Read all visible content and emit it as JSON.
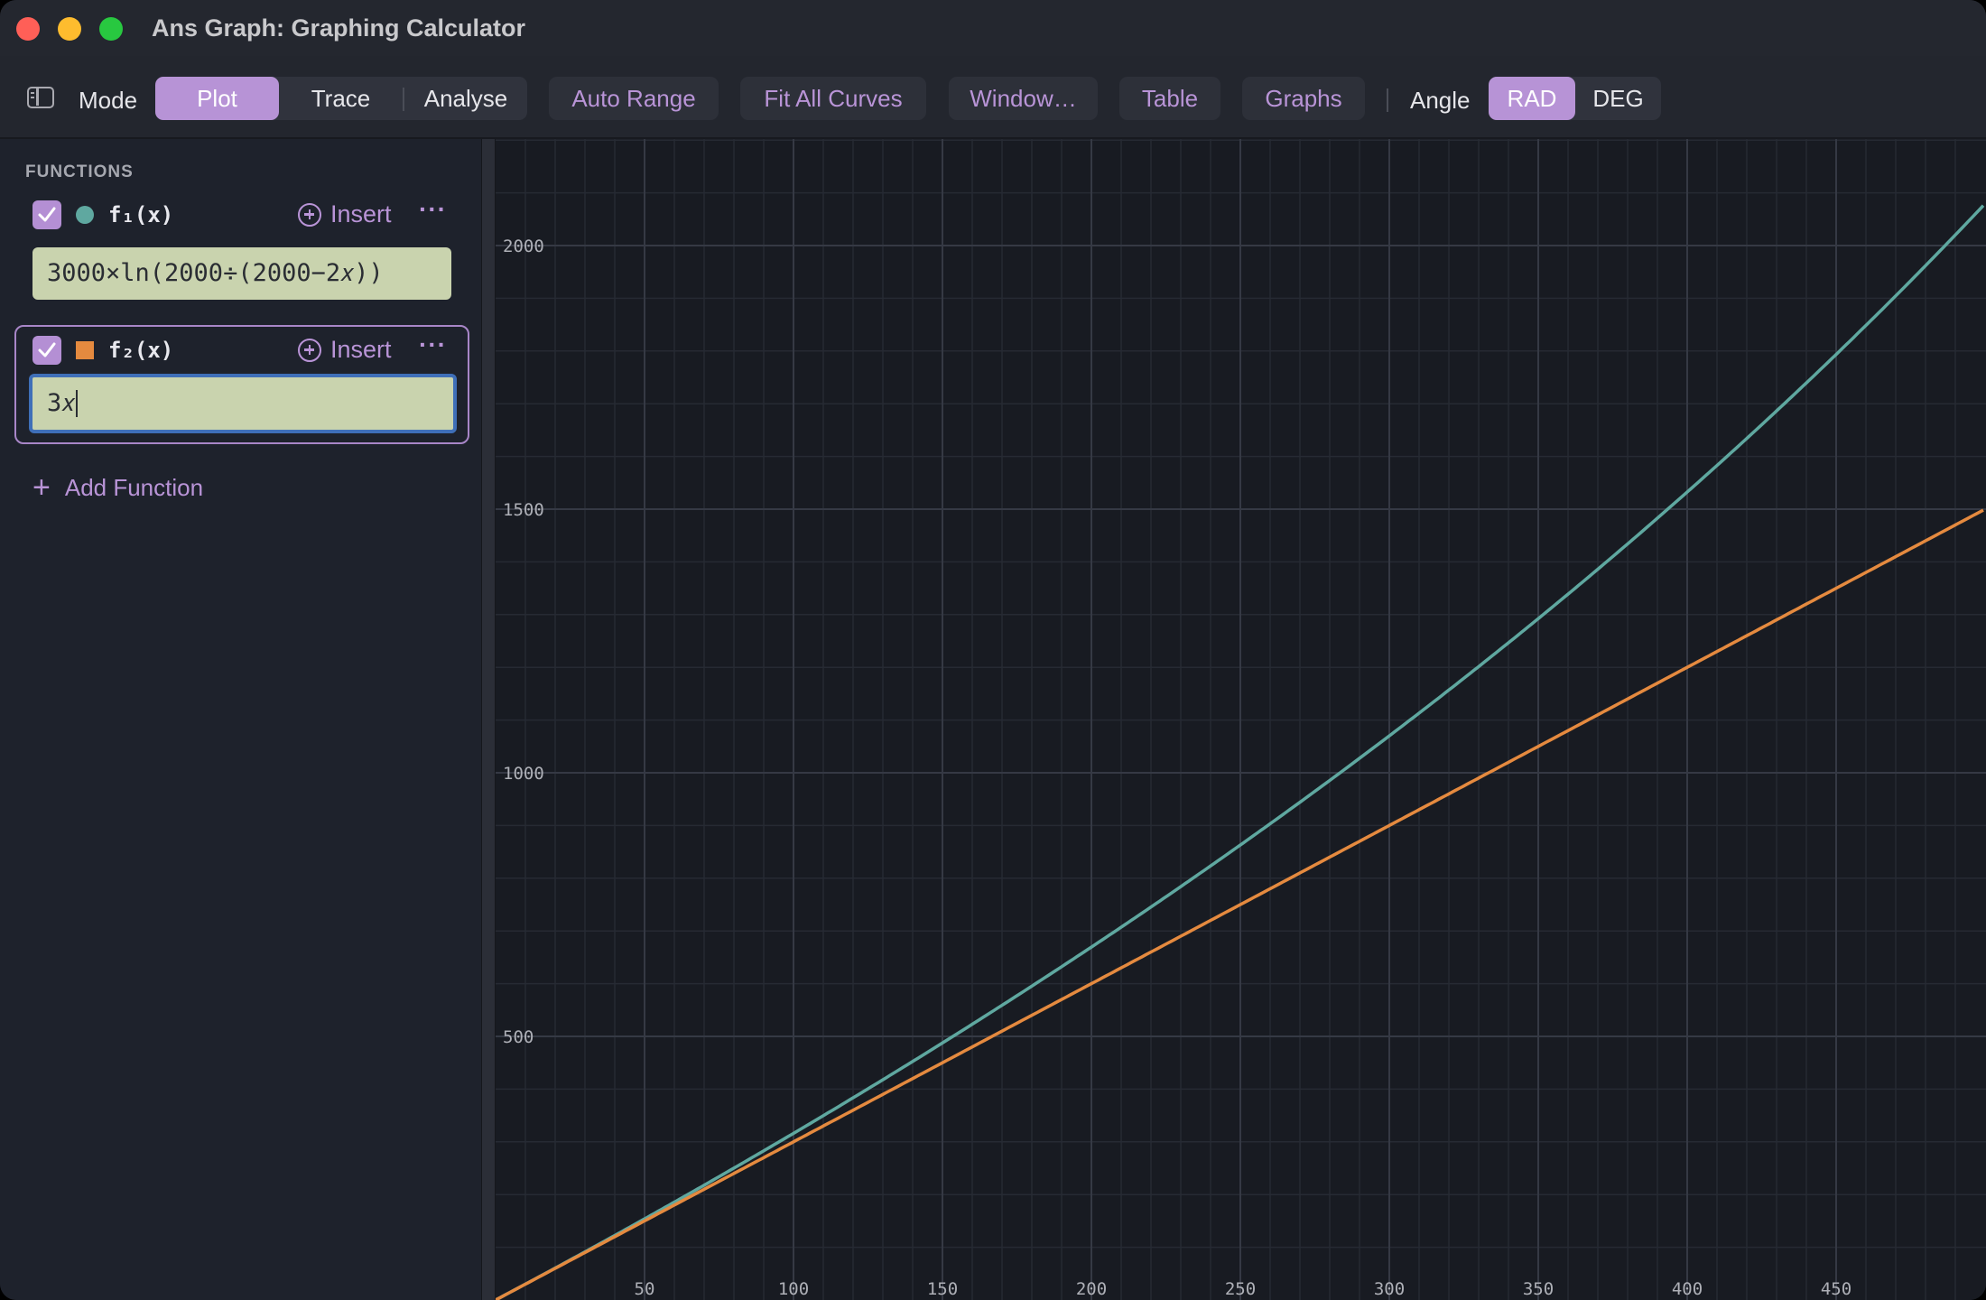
{
  "window": {
    "title": "Ans Graph: Graphing Calculator"
  },
  "toolbar": {
    "mode_label": "Mode",
    "mode_tabs": [
      "Plot",
      "Trace",
      "Analyse"
    ],
    "active_mode": "Plot",
    "buttons": [
      "Auto Range",
      "Fit All Curves",
      "Window…",
      "Table",
      "Graphs"
    ],
    "angle_label": "Angle",
    "angle_options": [
      "RAD",
      "DEG"
    ],
    "active_angle": "RAD"
  },
  "sidebar": {
    "section_title": "FUNCTIONS",
    "functions": [
      {
        "name": "f₁(x)",
        "expression": "3000×ln(2000÷(2000−2𝑥))",
        "enabled": true,
        "color": "#5fa8a0",
        "marker": "circle"
      },
      {
        "name": "f₂(x)",
        "expression": "3𝑥",
        "enabled": true,
        "color": "#e58a3f",
        "marker": "square"
      }
    ],
    "insert_label": "Insert",
    "more_label": "···",
    "add_function_label": "Add Function"
  },
  "chart_data": {
    "type": "line",
    "xlim": [
      0,
      500
    ],
    "ylim": [
      0,
      2000
    ],
    "x_ticks": [
      50,
      100,
      150,
      200,
      250,
      300,
      350,
      400,
      450
    ],
    "y_ticks": [
      500,
      1000,
      1500,
      2000
    ],
    "grid": true,
    "series": [
      {
        "name": "f₁(x)",
        "expression": "3000*ln(2000/(2000-2x))",
        "color": "#5fa8a0"
      },
      {
        "name": "f₂(x)",
        "expression": "3x",
        "color": "#e58a3f"
      }
    ]
  }
}
